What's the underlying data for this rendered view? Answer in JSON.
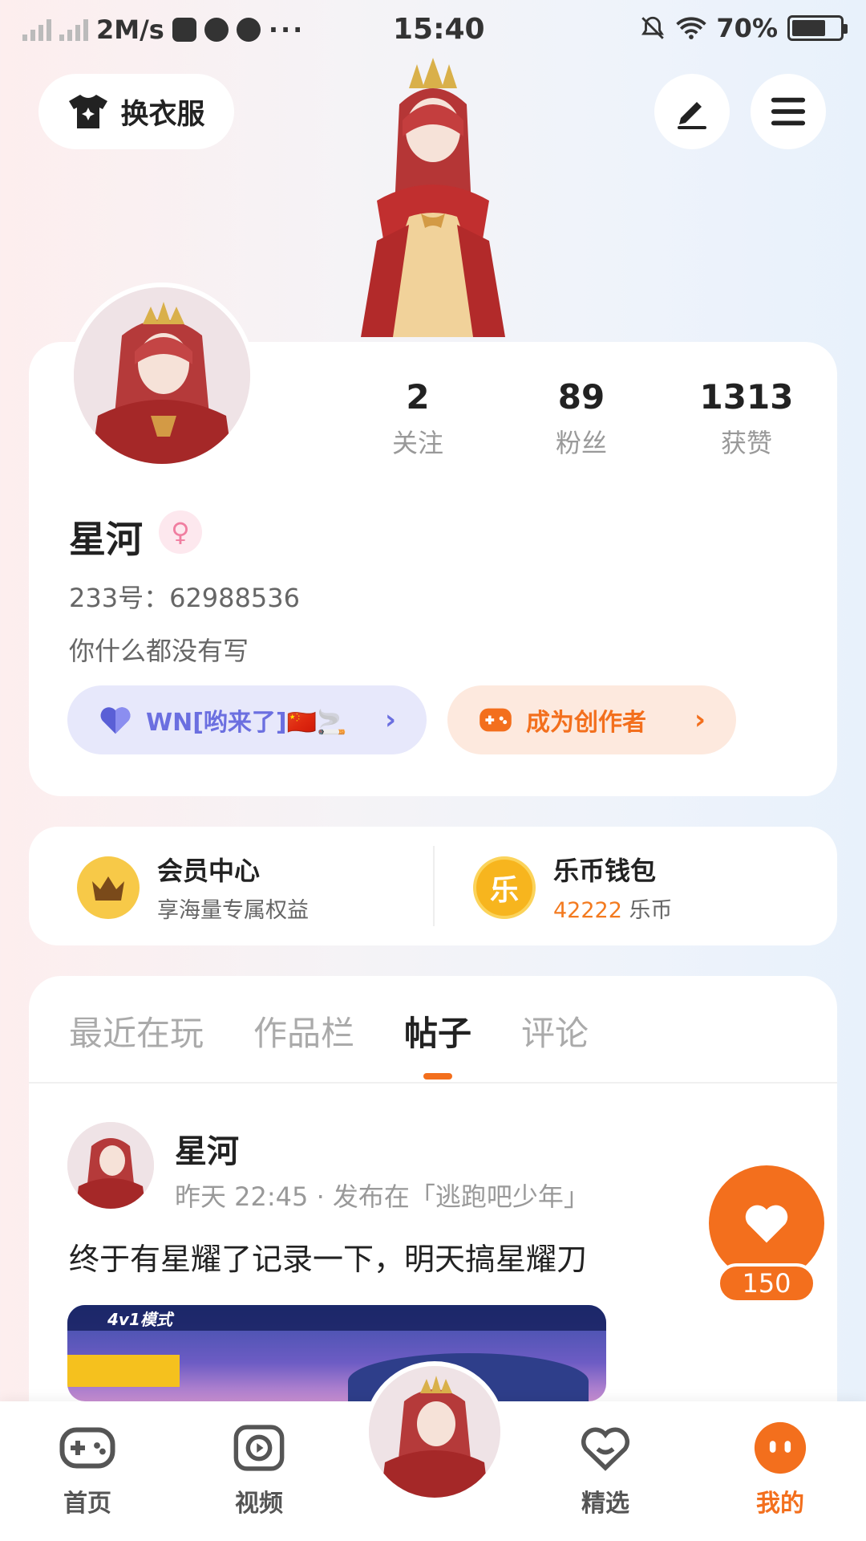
{
  "status_bar": {
    "speed": "2M/s",
    "time": "15:40",
    "battery": "70%",
    "battery_level": 0.7
  },
  "top": {
    "change_clothes_label": "换衣服"
  },
  "profile": {
    "stats": [
      {
        "value": "2",
        "label": "关注"
      },
      {
        "value": "89",
        "label": "粉丝"
      },
      {
        "value": "1313",
        "label": "获赞"
      }
    ],
    "name": "星河",
    "gender_symbol": "♀",
    "uid": "233号：62988536",
    "bio": "你什么都没有写",
    "guild_label": "WN[哟来了]🇨🇳🚬",
    "creator_label": "成为创作者"
  },
  "wallet": {
    "vip_title": "会员中心",
    "vip_sub": "享海量专属权益",
    "coin_title": "乐币钱包",
    "coin_amount": "42222",
    "coin_unit": "乐币",
    "coin_icon_text": "乐"
  },
  "tabs": [
    "最近在玩",
    "作品栏",
    "帖子",
    "评论"
  ],
  "active_tab": 2,
  "post": {
    "author": "星河",
    "meta": "昨天 22:45 · 发布在「逃跑吧少年」",
    "text": "终于有星耀了记录一下，明天搞星耀刀",
    "image_mode_label": "4v1模式",
    "likes": "150"
  },
  "nav": {
    "home": "首页",
    "video": "视频",
    "featured": "精选",
    "mine": "我的"
  },
  "colors": {
    "accent": "#f36f1d",
    "guild": "#6b6fe0"
  }
}
